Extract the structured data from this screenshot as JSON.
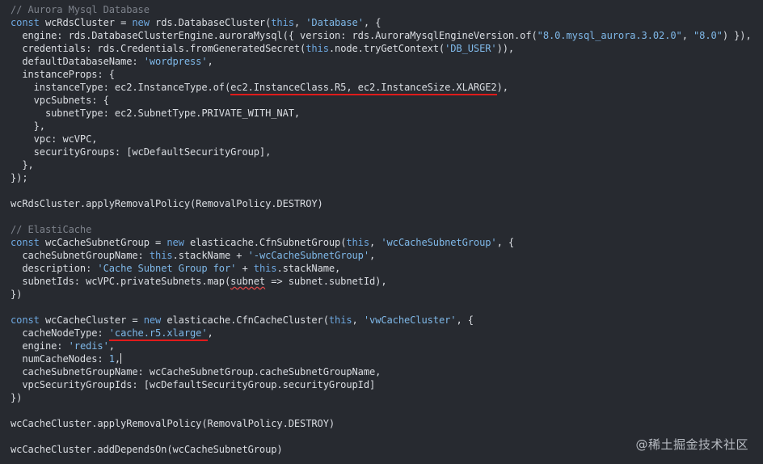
{
  "code": {
    "l01": "// Aurora Mysql Database",
    "l02a": "const",
    "l02b": " wcRdsCluster = ",
    "l02c": "new",
    "l02d": " rds.DatabaseCluster(",
    "l02e": "this",
    "l02f": ", ",
    "l02g": "'Database'",
    "l02h": ", {",
    "l03a": "  engine: rds.DatabaseClusterEngine.auroraMysql({ version: rds.AuroraMysqlEngineVersion.of(",
    "l03b": "\"8.0.mysql_aurora.3.02.0\"",
    "l03c": ", ",
    "l03d": "\"8.0\"",
    "l03e": ") }),",
    "l04a": "  credentials: rds.Credentials.fromGeneratedSecret(",
    "l04b": "this",
    "l04c": ".node.tryGetContext(",
    "l04d": "'DB_USER'",
    "l04e": ")),",
    "l05a": "  defaultDatabaseName: ",
    "l05b": "'wordpress'",
    "l05c": ",",
    "l06": "  instanceProps: {",
    "l07a": "    instanceType: ec2.InstanceType.of(",
    "l07b": "ec2.InstanceClass.R5, ec2.InstanceSize.XLARGE2",
    "l07c": "),",
    "l08": "    vpcSubnets: {",
    "l09": "      subnetType: ec2.SubnetType.PRIVATE_WITH_NAT,",
    "l10": "    },",
    "l11": "    vpc: wcVPC,",
    "l12": "    securityGroups: [wcDefaultSecurityGroup],",
    "l13": "  },",
    "l14": "});",
    "l15": "wcRdsCluster.applyRemovalPolicy(RemovalPolicy.DESTROY)",
    "l16": "// ElastiCache",
    "l17a": "const",
    "l17b": " wcCacheSubnetGroup = ",
    "l17c": "new",
    "l17d": " elasticache.CfnSubnetGroup(",
    "l17e": "this",
    "l17f": ", ",
    "l17g": "'wcCacheSubnetGroup'",
    "l17h": ", {",
    "l18a": "  cacheSubnetGroupName: ",
    "l18b": "this",
    "l18c": ".stackName + ",
    "l18d": "'-wcCacheSubnetGroup'",
    "l18e": ",",
    "l19a": "  description: ",
    "l19b": "'Cache Subnet Group for'",
    "l19c": " + ",
    "l19d": "this",
    "l19e": ".stackName,",
    "l20a": "  subnetIds: wcVPC.privateSubnets.map(",
    "l20b": "subnet",
    "l20c": " => subnet.subnetId),",
    "l21": "})",
    "l22a": "const",
    "l22b": " wcCacheCluster = ",
    "l22c": "new",
    "l22d": " elasticache.CfnCacheCluster(",
    "l22e": "this",
    "l22f": ", ",
    "l22g": "'vwCacheCluster'",
    "l22h": ", {",
    "l23a": "  cacheNodeType: ",
    "l23b": "'cache.r5.xlarge'",
    "l23c": ",",
    "l24a": "  engine: ",
    "l24b": "'redis'",
    "l24c": ",",
    "l25a": "  numCacheNodes: ",
    "l25b": "1",
    "l25c": ",",
    "l26": "  cacheSubnetGroupName: wcCacheSubnetGroup.cacheSubnetGroupName,",
    "l27": "  vpcSecurityGroupIds: [wcDefaultSecurityGroup.securityGroupId]",
    "l28": "})",
    "l29": "wcCacheCluster.applyRemovalPolicy(RemovalPolicy.DESTROY)",
    "l30": "wcCacheCluster.addDependsOn(wcCacheSubnetGroup)"
  },
  "watermark": "@稀土掘金技术社区",
  "colors": {
    "background": "#272a30",
    "keyword": "#6ea8e0",
    "string": "#7fb8e8",
    "comment": "#7d828b",
    "highlight_underline": "#e01b1b"
  }
}
